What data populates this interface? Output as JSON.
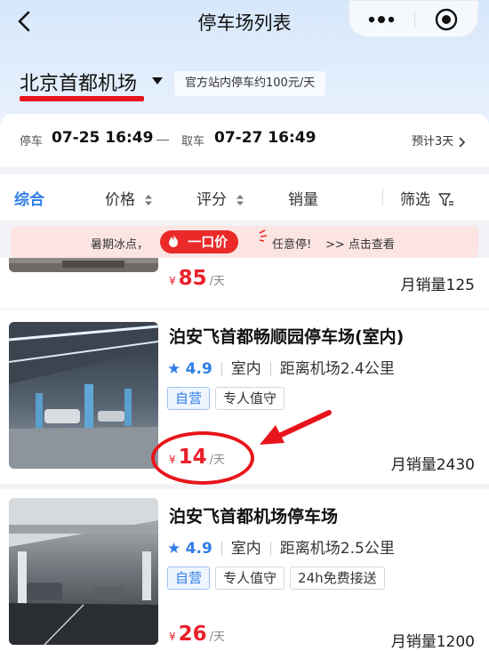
{
  "header": {
    "title": "停车场列表"
  },
  "location": {
    "city": "北京首都机场",
    "notice": "官方站内停车约100元/天"
  },
  "dates": {
    "park_label": "停车",
    "park_time": "07-25 16:49",
    "pickup_label": "取车",
    "pickup_time": "07-27 16:49",
    "estimate": "预计3天"
  },
  "sort": {
    "default": "综合",
    "price": "价格",
    "rating": "评分",
    "sales": "销量",
    "filter": "筛选"
  },
  "promo": {
    "left": "暑期冰点，",
    "pill": "一口价",
    "mid": "任意停!",
    "right": ">> 点击查看"
  },
  "lots": [
    {
      "price_symbol": "¥",
      "price": "85",
      "unit": "/天",
      "sales": "月销量125"
    },
    {
      "name": "泊安飞首都畅顺园停车场(室内)",
      "rating": "4.9",
      "type": "室内",
      "distance": "距离机场2.4公里",
      "tags": [
        "自营",
        "专人值守"
      ],
      "price_symbol": "¥",
      "price": "14",
      "unit": "/天",
      "sales": "月销量2430"
    },
    {
      "name": "泊安飞首都机场停车场",
      "rating": "4.9",
      "type": "室内",
      "distance": "距离机场2.5公里",
      "tags": [
        "自营",
        "专人值守",
        "24h免费接送"
      ],
      "price_symbol": "¥",
      "price": "26",
      "unit": "/天",
      "sales": "月销量1200"
    }
  ],
  "colors": {
    "accent": "#2e7ee6",
    "price": "#e8202a",
    "annotation": "#e8141b"
  }
}
